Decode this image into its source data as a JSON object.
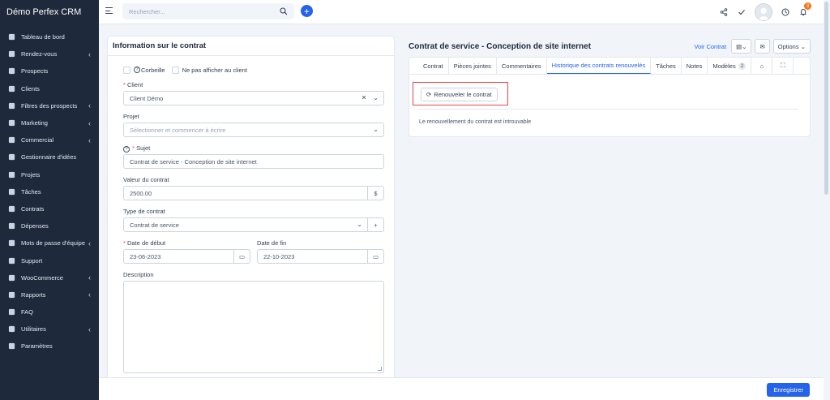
{
  "app": {
    "title": "Démo Perfex CRM"
  },
  "colors": {
    "accent": "#2563eb",
    "sidebar": "#1e293b",
    "required": "#ef4444",
    "badge": "#f97316",
    "highlight_box": "#ef4444"
  },
  "sidebar": {
    "items": [
      {
        "label": "Tableau de bord",
        "icon": "home-icon",
        "chevron": false
      },
      {
        "label": "Rendez-vous",
        "icon": "calendar-icon",
        "chevron": true
      },
      {
        "label": "Prospects",
        "icon": "leads-icon",
        "chevron": false
      },
      {
        "label": "Clients",
        "icon": "user-icon",
        "chevron": false
      },
      {
        "label": "Filtres des prospects",
        "icon": "filter-icon",
        "chevron": true
      },
      {
        "label": "Marketing",
        "icon": "target-icon",
        "chevron": true
      },
      {
        "label": "Commercial",
        "icon": "balance-icon",
        "chevron": true
      },
      {
        "label": "Gestionnaire d'idées",
        "icon": "bulb-icon",
        "chevron": false
      },
      {
        "label": "Projets",
        "icon": "chart-icon",
        "chevron": false
      },
      {
        "label": "Tâches",
        "icon": "check-circle-icon",
        "chevron": false
      },
      {
        "label": "Contrats",
        "icon": "file-icon",
        "chevron": false
      },
      {
        "label": "Dépenses",
        "icon": "file-text-icon",
        "chevron": false
      },
      {
        "label": "Mots de passe d'équipe",
        "icon": "key-icon",
        "chevron": true
      },
      {
        "label": "Support",
        "icon": "lifebuoy-icon",
        "chevron": false
      },
      {
        "label": "WooCommerce",
        "icon": "cart-icon",
        "chevron": true
      },
      {
        "label": "Rapports",
        "icon": "bar-chart-icon",
        "chevron": true
      },
      {
        "label": "FAQ",
        "icon": "folder-icon",
        "chevron": false
      },
      {
        "label": "Utilitaires",
        "icon": "cogs-icon",
        "chevron": true
      },
      {
        "label": "Paramètres",
        "icon": "gear-icon",
        "chevron": false
      }
    ]
  },
  "topbar": {
    "search_placeholder": "Rechercher...",
    "notification_count": "3"
  },
  "left_panel": {
    "title": "Information sur le contrat",
    "trash_label": "Corbeille",
    "hide_client_label": "Ne pas afficher au client",
    "client_label": "Client",
    "client_value": "Client Démo",
    "project_label": "Projet",
    "project_placeholder": "Sélectionner et commencer à écrire",
    "subject_label": "Sujet",
    "subject_value": "Contrat de service - Conception de site internet",
    "value_label": "Valeur du contrat",
    "value_value": "2500.00",
    "currency": "$",
    "type_label": "Type de contrat",
    "type_value": "Contrat de service",
    "start_label": "Date de début",
    "start_value": "23-06-2023",
    "end_label": "Date de fin",
    "end_value": "22-10-2023",
    "description_label": "Description"
  },
  "right_panel": {
    "title": "Contrat de service - Conception de site internet",
    "view_link": "Voir Contrat",
    "options_label": "Options",
    "tabs": [
      {
        "label": "Contrat"
      },
      {
        "label": "Pièces jointes"
      },
      {
        "label": "Commentaires"
      },
      {
        "label": "Historique des contrats renouvelés",
        "active": true
      },
      {
        "label": "Tâches"
      },
      {
        "label": "Notes"
      },
      {
        "label": "Modèles",
        "count": "2"
      }
    ],
    "renew_button": "Renouveler le contrat",
    "empty_message": "Le renouvellement du contrat est introuvable"
  },
  "footer": {
    "save_button": "Enregistrer"
  }
}
